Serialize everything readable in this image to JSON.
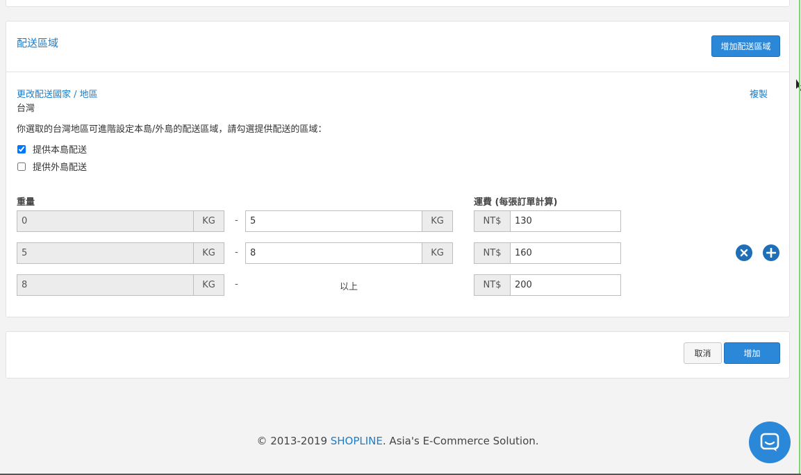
{
  "region_section": {
    "title": "配送區域",
    "add_region_label": "增加配送區域",
    "change_country_label": "更改配送國家 / 地區",
    "copy_label": "複製",
    "country": "台灣",
    "instruction": "你選取的台灣地區可進階設定本島/外島的配送區域，請勾選提供配送的區域：",
    "options": [
      {
        "label": "提供本島配送",
        "checked": true
      },
      {
        "label": "提供外島配送",
        "checked": false
      }
    ]
  },
  "rates": {
    "weight_header": "重量",
    "fee_header": "運費 (每張訂單計算)",
    "unit": "KG",
    "currency": "NT$",
    "separator": "-",
    "above_label": "以上",
    "rows": [
      {
        "from": "0",
        "to": "5",
        "fee": "130"
      },
      {
        "from": "5",
        "to": "8",
        "fee": "160"
      },
      {
        "from": "8",
        "to": "",
        "fee": "200"
      }
    ]
  },
  "actions": {
    "cancel_label": "取消",
    "submit_label": "增加"
  },
  "footer": {
    "prefix": "© 2013-2019 ",
    "brand": "SHOPLINE",
    "suffix": ". Asia's E-Commerce Solution."
  },
  "colors": {
    "accent": "#2b87d8",
    "link": "#1e7bc4",
    "icon_blue": "#1e6fb8"
  }
}
